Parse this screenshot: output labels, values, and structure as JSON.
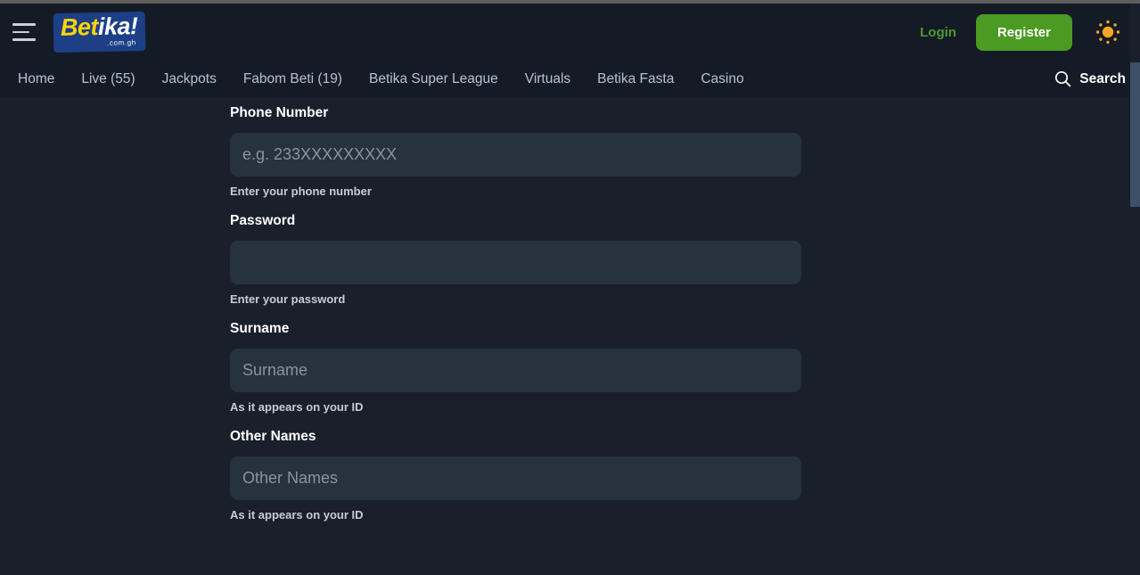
{
  "brand": {
    "wordmark_part_a": "Bet",
    "wordmark_part_b": "ika!",
    "tld": ".com.gh",
    "logo_background": "#1c3f86",
    "accent_yellow": "#ffd500"
  },
  "header": {
    "menu_icon": "hamburger-icon",
    "login_label": "Login",
    "register_label": "Register",
    "theme_icon": "sun-icon",
    "login_color": "#4e9a2e",
    "register_background": "#4b9a22",
    "theme_icon_color": "#f5a623"
  },
  "nav": {
    "items": [
      {
        "label": "Home"
      },
      {
        "label": "Live (55)"
      },
      {
        "label": "Jackpots"
      },
      {
        "label": "Fabom Beti (19)"
      },
      {
        "label": "Betika Super League"
      },
      {
        "label": "Virtuals"
      },
      {
        "label": "Betika Fasta"
      },
      {
        "label": "Casino"
      }
    ],
    "search": {
      "icon": "search-icon",
      "label": "Search"
    }
  },
  "form": {
    "fields": [
      {
        "label": "Phone Number",
        "placeholder": "e.g. 233XXXXXXXXX",
        "value": "",
        "hint": "Enter your phone number",
        "type": "tel"
      },
      {
        "label": "Password",
        "placeholder": "",
        "value": "",
        "hint": "Enter your password",
        "type": "password"
      },
      {
        "label": "Surname",
        "placeholder": "Surname",
        "value": "",
        "hint": "As it appears on your ID",
        "type": "text"
      },
      {
        "label": "Other Names",
        "placeholder": "Other Names",
        "value": "",
        "hint": "As it appears on your ID",
        "type": "text"
      }
    ]
  },
  "theme": {
    "page_background": "#19202c",
    "header_background": "#141b26",
    "input_background": "#26323e",
    "scrollbar_thumb": "#3c5168"
  }
}
